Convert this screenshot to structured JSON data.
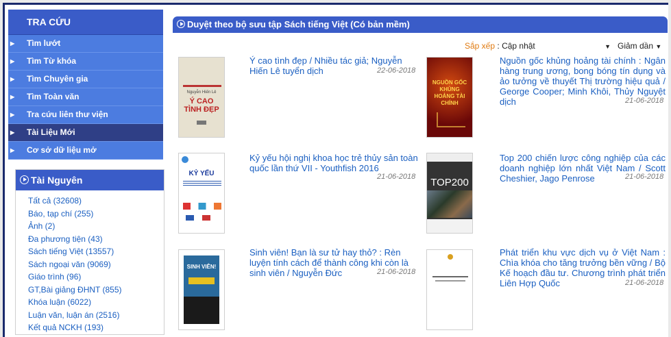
{
  "sidebar": {
    "header": "TRA CỨU",
    "items": [
      {
        "label": "Tìm lướt"
      },
      {
        "label": "Tìm Từ khóa"
      },
      {
        "label": "Tìm Chuyên gia"
      },
      {
        "label": "Tìm Toàn văn"
      },
      {
        "label": "Tra cứu liên thư viện"
      },
      {
        "label": "Tài Liệu Mới"
      },
      {
        "label": "Cơ sở dữ liệu mở"
      }
    ]
  },
  "resources": {
    "header": "Tài Nguyên",
    "items": [
      "Tất cả (32608)",
      "Báo, tạp chí (255)",
      "Ảnh (2)",
      "Đa phương tiện (43)",
      "Sách tiếng Việt (13557)",
      "Sách ngoại văn (9069)",
      "Giáo trình (96)",
      "GT,Bài giảng ĐHNT (855)",
      "Khóa luận (6022)",
      "Luận văn, luận án (2516)",
      "Kết quả NCKH (193)"
    ]
  },
  "main": {
    "header": "Duyệt theo bộ sưu tập Sách tiếng Việt (Có bản mềm)",
    "sort_label": "Sắp xếp",
    "sort_value": "Cập nhật",
    "order_value": "Giảm dần"
  },
  "books": [
    {
      "title": "Ý cao tình đẹp / Nhiều tác giả; Nguyễn Hiến Lê tuyển dịch",
      "date": "22-06-2018",
      "cover_text": "Ý CAO TÌNH ĐẸP",
      "cover_author": "Nguyễn Hiến Lê"
    },
    {
      "title": "Nguồn gốc khủng hoảng tài chính : Ngân hàng trung ương, bong bóng tín dụng và ảo tưởng về thuyết Thị trường hiệu quả / George Cooper; Minh Khôi, Thủy Nguyệt dịch",
      "date": "21-06-2018",
      "cover_text": "NGUỒN GỐC KHỦNG HOẢNG TÀI CHÍNH"
    },
    {
      "title": "Kỷ yếu hội nghị khoa học trẻ thủy sản toàn quốc lần thứ VII - Youthfish 2016",
      "date": "21-06-2018",
      "cover_text": "KỶ YẾU"
    },
    {
      "title": "Top 200 chiến lược công nghiệp của các doanh nghiệp lớn nhất Việt Nam / Scott Cheshier, Jago Penrose",
      "date": "21-06-2018",
      "cover_text": "TOP200"
    },
    {
      "title": "Sinh viên! Bạn là sư tử hay thỏ? : Rèn luyện tính cách để thành công khi còn là sinh viên / Nguyễn Đức",
      "date": "21-06-2018",
      "cover_text": "SINH VIÊN!"
    },
    {
      "title": "Phát triển khu vực dịch vụ ở Việt Nam : Chìa khóa cho tăng trưởng bền vững / Bộ Kế hoạch đầu tư. Chương trình phát triển Liên Hợp Quốc",
      "date": "21-06-2018"
    }
  ]
}
